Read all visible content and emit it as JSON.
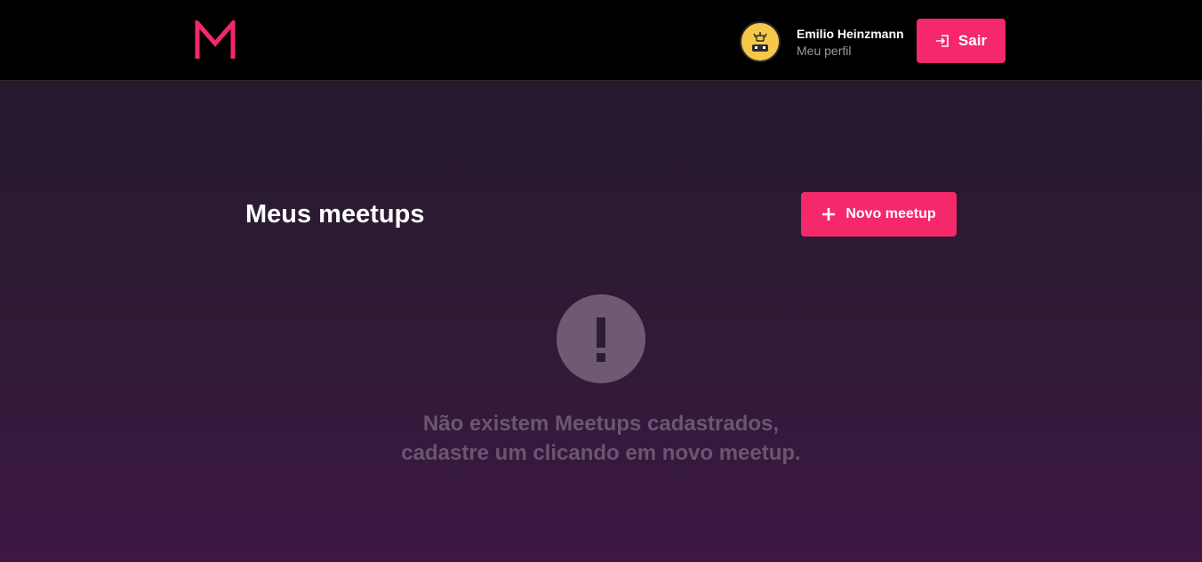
{
  "header": {
    "logo_letter": "M",
    "brand_color": "#f5286b",
    "user": {
      "name": "Emilio Heinzmann",
      "profile_link": "Meu perfil"
    },
    "logout": {
      "label": "Sair",
      "icon": "logout-icon"
    }
  },
  "main": {
    "title": "Meus meetups",
    "new_button": {
      "label": "Novo meetup",
      "icon": "plus-icon"
    },
    "empty_state": {
      "icon": "exclamation-icon",
      "line1": "Não existem Meetups cadastrados,",
      "line2": "cadastre um clicando em novo meetup."
    }
  }
}
